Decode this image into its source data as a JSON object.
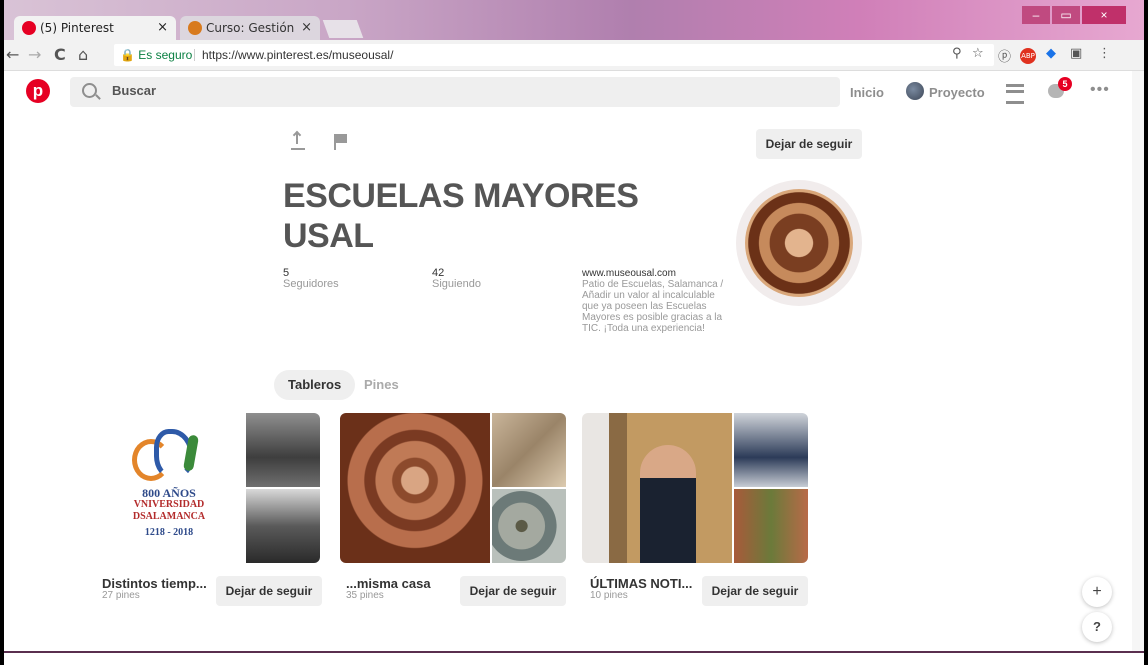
{
  "browser": {
    "tabs": [
      {
        "label": "(5) Pinterest",
        "close": "×"
      },
      {
        "label": "Curso: Gestión del patrim",
        "close": "×"
      }
    ],
    "window_controls": [
      "–",
      "▭",
      "×"
    ],
    "nav": {
      "back": "←",
      "forward": "→",
      "reload": "C",
      "home": "⌂"
    },
    "secure_label": "Es seguro",
    "url": "https://www.pinterest.es/museousal/",
    "ext_icons": [
      "⚲",
      "☆",
      "ⓟ",
      "ABP",
      "◆",
      "▣",
      "⋮"
    ]
  },
  "pinterest": {
    "logo": "p",
    "search_placeholder": "Buscar",
    "home_link": "Inicio",
    "profile_link": "Proyecto",
    "notifications_count": "5",
    "more": "•••"
  },
  "profile": {
    "follow_button": "Dejar de seguir",
    "name_line1": "ESCUELAS MAYORES",
    "name_line2": "USAL",
    "followers_count": "5",
    "followers_label": "Seguidores",
    "following_count": "42",
    "following_label": "Siguiendo",
    "website": "www.museousal.com",
    "about": "Patio de Escuelas, Salamanca / Añadir un valor al incalculable que ya poseen las Escuelas Mayores es posible gracias a la TIC. ¡Toda una experiencia!",
    "tabs": [
      "Tableros",
      "Pines"
    ]
  },
  "boards": [
    {
      "name": "Distintos tiemp...",
      "count": "27 pines",
      "button": "Dejar de seguir",
      "logo_lines": [
        "800 AÑOS",
        "VNIVERSIDAD",
        "DSALAMANCA",
        "1218 - 2018"
      ]
    },
    {
      "name": "...misma casa",
      "count": "35 pines",
      "button": "Dejar de seguir"
    },
    {
      "name": "ÚLTIMAS NOTI...",
      "count": "10 pines",
      "button": "Dejar de seguir"
    }
  ],
  "fabs": {
    "add": "+",
    "help": "?"
  }
}
